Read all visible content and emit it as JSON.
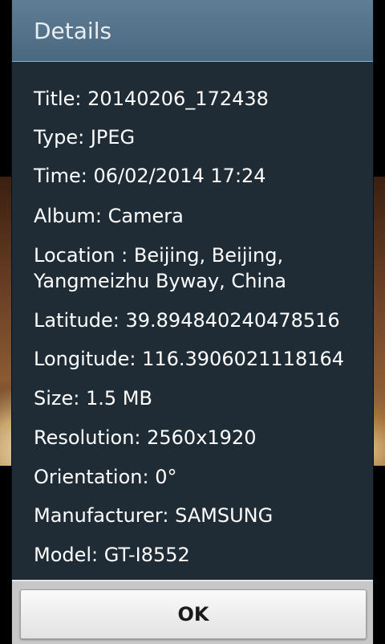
{
  "dialog": {
    "title": "Details",
    "items": [
      "Title: 20140206_172438",
      "Type: JPEG",
      "Time: 06/02/2014 17:24",
      "Album: Camera",
      "Location : Beijing, Beijing,\nYangmeizhu Byway, China",
      "Latitude: 39.894840240478516",
      "Longitude: 116.3906021118164",
      "Size: 1.5 MB",
      "Resolution: 2560x1920",
      "Orientation: 0°",
      "Manufacturer: SAMSUNG",
      "Model: GT-I8552"
    ],
    "ok_label": "OK"
  },
  "colors": {
    "dialog_bg": "#1f2c36",
    "header_bg": "#4a6880",
    "footer_bg": "#c7c7c7"
  }
}
